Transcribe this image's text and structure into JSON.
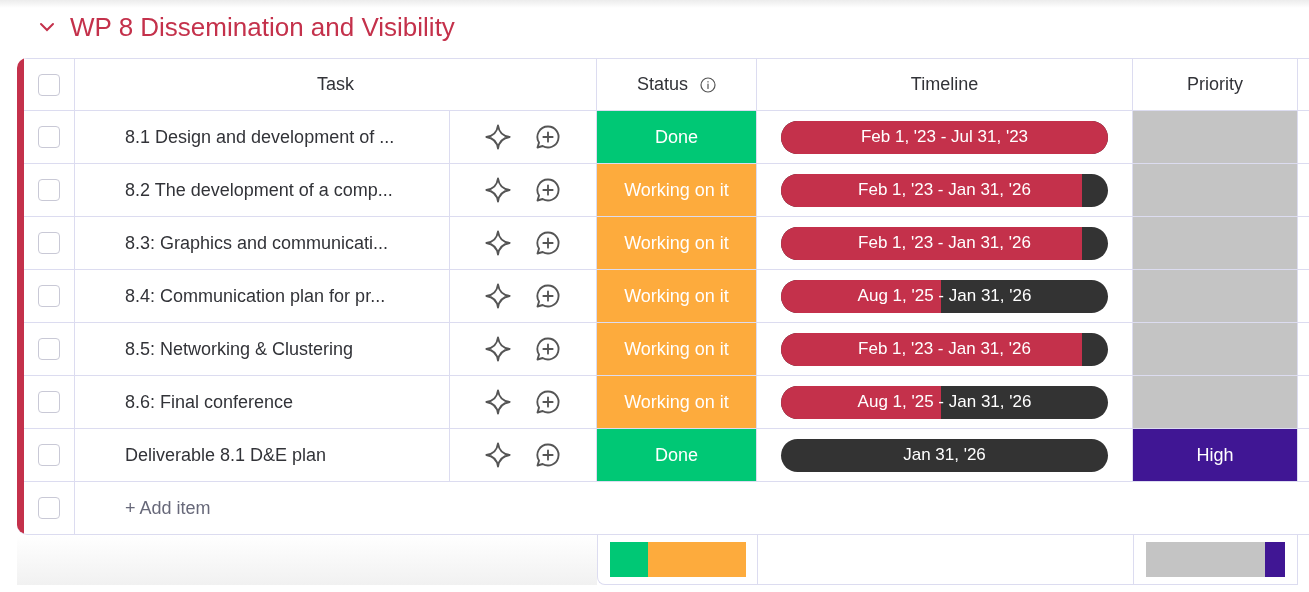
{
  "group": {
    "title": "WP 8 Dissemination and Visibility",
    "color": "#c4314b",
    "expanded": true
  },
  "columns": {
    "checked": false,
    "task": "Task",
    "status": "Status",
    "timeline": "Timeline",
    "priority": "Priority"
  },
  "rows": [
    {
      "task": "8.1 Design and development of ...",
      "checked": false,
      "status": {
        "label": "Done",
        "color": "#00c875"
      },
      "timeline": {
        "label": "Feb 1, '23 - Jul 31, '23",
        "level": 1
      },
      "priority": {
        "color": "#c4c4c4"
      }
    },
    {
      "task": "8.2 The development of a comp...",
      "checked": false,
      "status": {
        "label": "Working on it",
        "color": "#fdab3d"
      },
      "timeline": {
        "label": "Feb 1, '23 - Jan 31, '26",
        "level": 0.92
      },
      "priority": {
        "color": "#c4c4c4"
      }
    },
    {
      "task": "8.3: Graphics and communicati...",
      "checked": false,
      "status": {
        "label": "Working on it",
        "color": "#fdab3d"
      },
      "timeline": {
        "label": "Feb 1, '23 - Jan 31, '26",
        "level": 0.92
      },
      "priority": {
        "color": "#c4c4c4"
      }
    },
    {
      "task": "8.4: Communication plan for pr...",
      "checked": false,
      "status": {
        "label": "Working on it",
        "color": "#fdab3d"
      },
      "timeline": {
        "label": "Aug 1, '25 - Jan 31, '26",
        "level": 0.49
      },
      "priority": {
        "color": "#c4c4c4"
      }
    },
    {
      "task": "8.5: Networking & Clustering",
      "checked": false,
      "status": {
        "label": "Working on it",
        "color": "#fdab3d"
      },
      "timeline": {
        "label": "Feb 1, '23 - Jan 31, '26",
        "level": 0.92
      },
      "priority": {
        "color": "#c4c4c4"
      }
    },
    {
      "task": "8.6: Final conference",
      "checked": false,
      "status": {
        "label": "Working on it",
        "color": "#fdab3d"
      },
      "timeline": {
        "label": "Aug 1, '25 - Jan 31, '26",
        "level": 0.49
      },
      "priority": {
        "color": "#c4c4c4"
      }
    },
    {
      "task": "Deliverable 8.1 D&E plan",
      "checked": false,
      "status": {
        "label": "Done",
        "color": "#00c875"
      },
      "timeline": {
        "label": "Jan 31, '26",
        "level": 0
      },
      "priority": {
        "label": "High",
        "color": "#401694"
      }
    }
  ],
  "add_item": {
    "label": "+ Add item",
    "checked": false
  }
}
